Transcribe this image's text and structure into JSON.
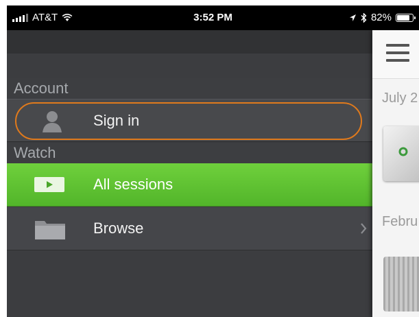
{
  "status_bar": {
    "carrier": "AT&T",
    "time": "3:52 PM",
    "battery_percent": "82%",
    "battery_level": 0.82
  },
  "menu": {
    "sections": [
      {
        "header": "Account",
        "items": [
          {
            "label": "Sign in",
            "icon": "person-icon"
          }
        ]
      },
      {
        "header": "Watch",
        "items": [
          {
            "label": "All sessions",
            "icon": "play-icon",
            "selected": true
          },
          {
            "label": "Browse",
            "icon": "folder-icon",
            "has_chevron": true
          }
        ]
      }
    ]
  },
  "content": {
    "dates": [
      "July 2",
      "Febru"
    ]
  },
  "colors": {
    "selected_row": "#5cc232",
    "highlight_ring": "#e07a1c",
    "drawer_bg": "#3c3d40"
  }
}
